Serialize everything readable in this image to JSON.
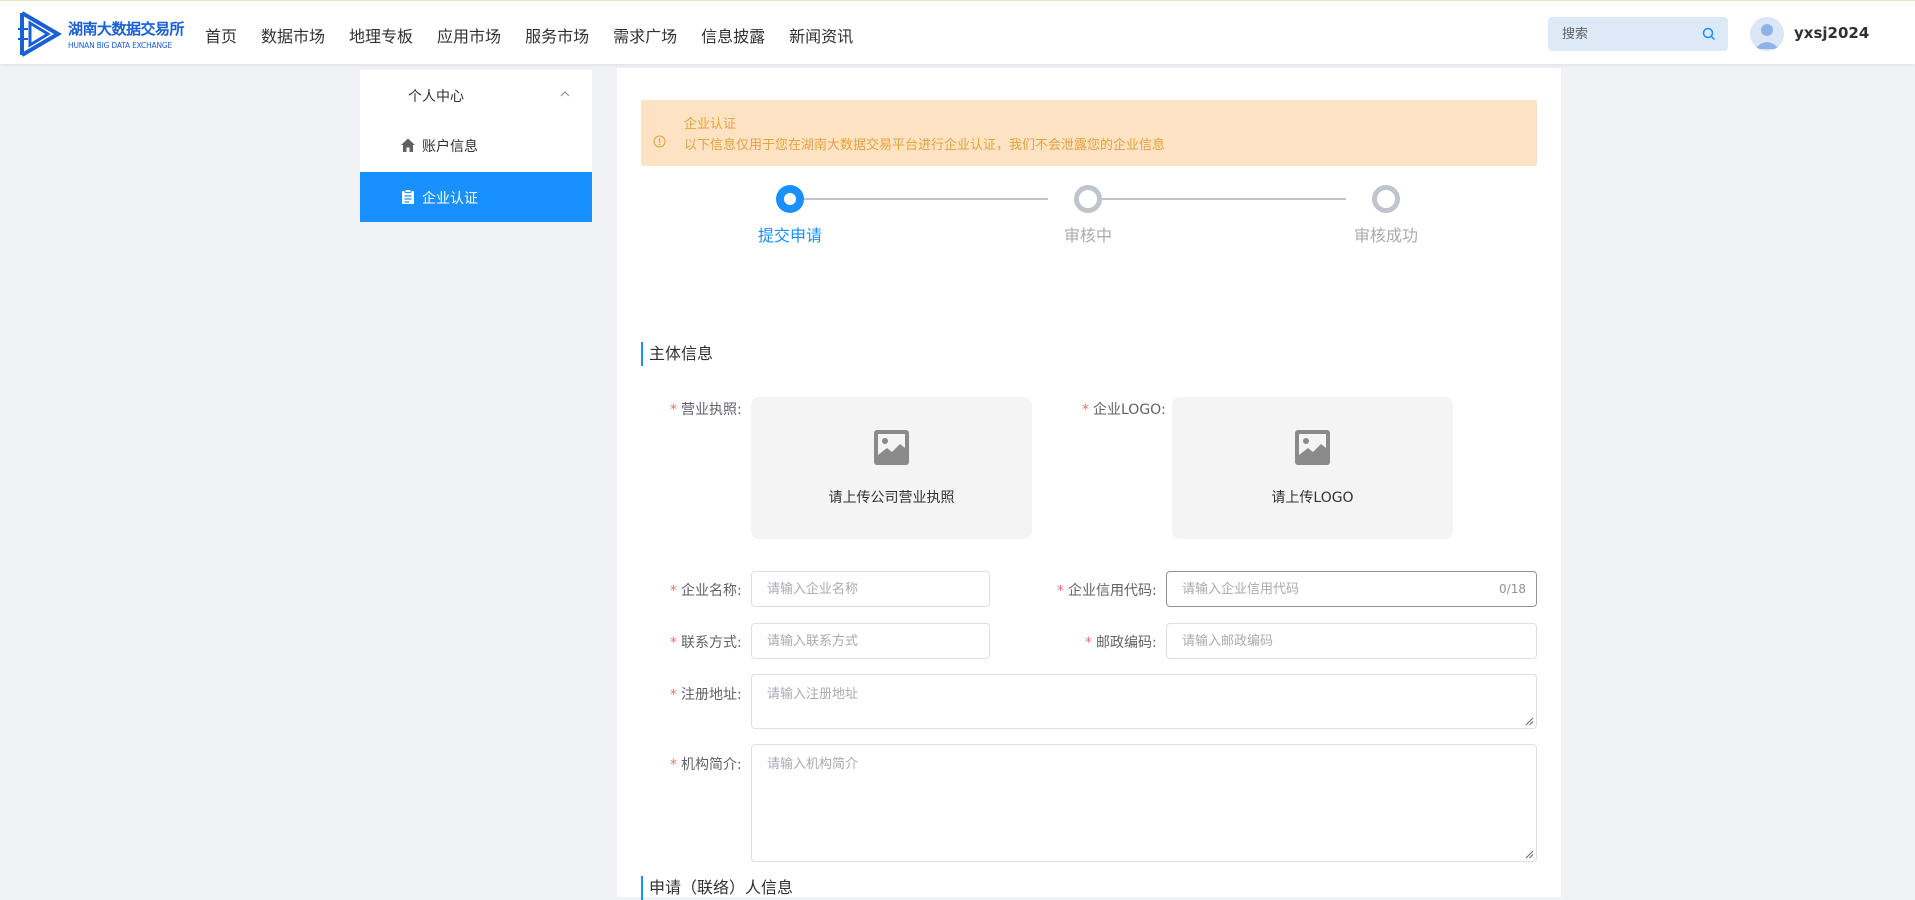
{
  "header": {
    "logo_cn": "湖南大数据交易所",
    "logo_en": "HUNAN BIG DATA EXCHANGE",
    "nav": [
      "首页",
      "数据市场",
      "地理专板",
      "应用市场",
      "服务市场",
      "需求广场",
      "信息披露",
      "新闻资讯"
    ],
    "search_placeholder": "搜索",
    "username": "yxsj2024"
  },
  "sidebar": {
    "group_label": "个人中心",
    "items": [
      {
        "label": "账户信息",
        "icon": "home-icon"
      },
      {
        "label": "企业认证",
        "icon": "document-icon",
        "active": true
      }
    ]
  },
  "alert": {
    "title": "企业认证",
    "description": "以下信息仅用于您在湖南大数据交易平台进行企业认证，我们不会泄露您的企业信息"
  },
  "steps": [
    {
      "label": "提交申请",
      "status": "done"
    },
    {
      "label": "审核中",
      "status": "wait"
    },
    {
      "label": "审核成功",
      "status": "wait"
    }
  ],
  "form": {
    "section_main": "主体信息",
    "section_applicant": "申请（联络）人信息",
    "license_label": "营业执照:",
    "license_hint": "请上传公司营业执照",
    "logo_label": "企业LOGO:",
    "logo_hint": "请上传LOGO",
    "company_name_label": "企业名称:",
    "company_name_placeholder": "请输入企业名称",
    "credit_code_label": "企业信用代码:",
    "credit_code_placeholder": "请输入企业信用代码",
    "credit_code_count": "0/18",
    "contact_label": "联系方式:",
    "contact_placeholder": "请输入联系方式",
    "postal_label": "邮政编码:",
    "postal_placeholder": "请输入邮政编码",
    "address_label": "注册地址:",
    "address_placeholder": "请输入注册地址",
    "intro_label": "机构简介:",
    "intro_placeholder": "请输入机构简介"
  },
  "colors": {
    "primary": "#1890ff",
    "alert_bg": "#fde3c3",
    "alert_text": "#e6a23c",
    "required": "#f56c6c"
  }
}
